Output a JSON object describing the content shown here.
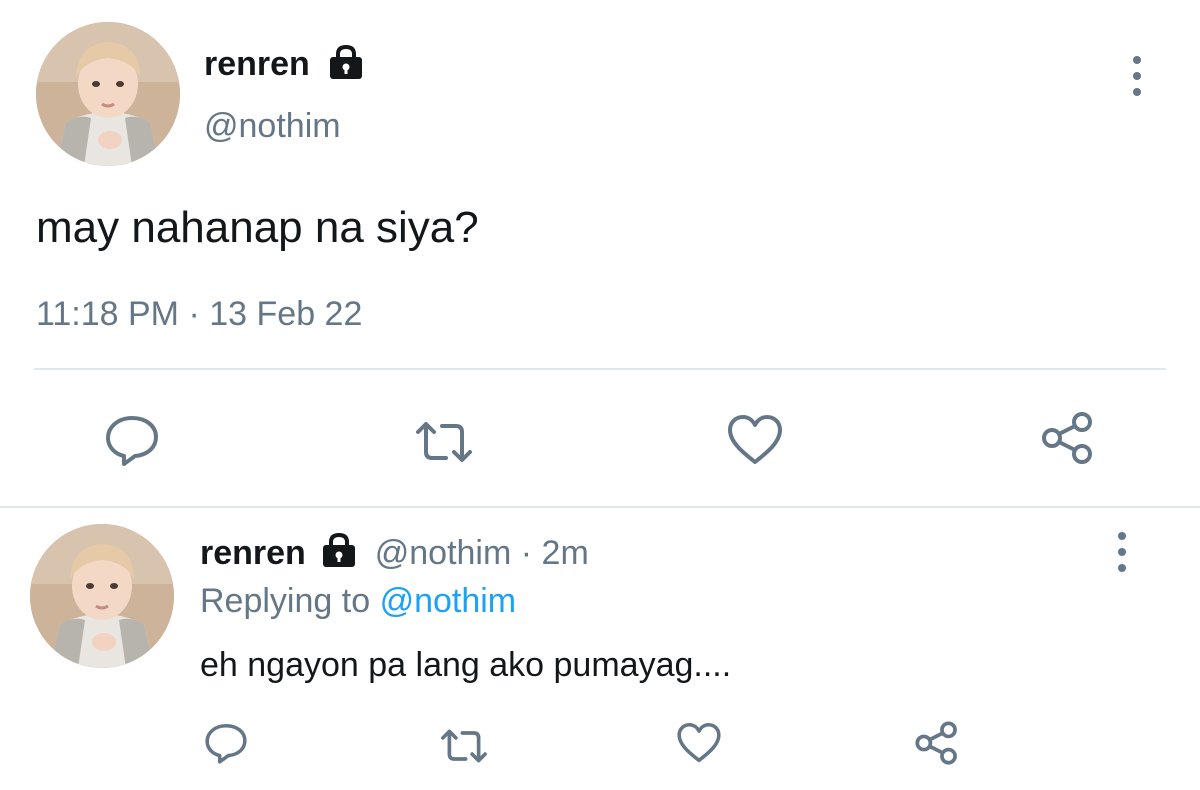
{
  "main_tweet": {
    "display_name": "renren",
    "handle": "@nothim",
    "protected_icon": "lock-icon",
    "text": "may nahanap na siya?",
    "time": "11:18 PM",
    "separator": "·",
    "date": "13 Feb 22",
    "actions": [
      "reply-icon",
      "retweet-icon",
      "like-icon",
      "share-icon"
    ],
    "more_icon": "more-options-icon"
  },
  "reply_tweet": {
    "display_name": "renren",
    "handle": "@nothim",
    "protected_icon": "lock-icon",
    "separator": "·",
    "age": "2m",
    "replying_prefix": "Replying to",
    "replying_to": "@nothim",
    "text": "eh ngayon pa lang ako pumayag....",
    "actions": [
      "reply-icon",
      "retweet-icon",
      "like-icon",
      "share-icon"
    ],
    "more_icon": "more-options-icon"
  },
  "colors": {
    "text": "#14171a",
    "muted": "#657786",
    "link": "#1da1f2",
    "divider": "#e1e8ed"
  }
}
